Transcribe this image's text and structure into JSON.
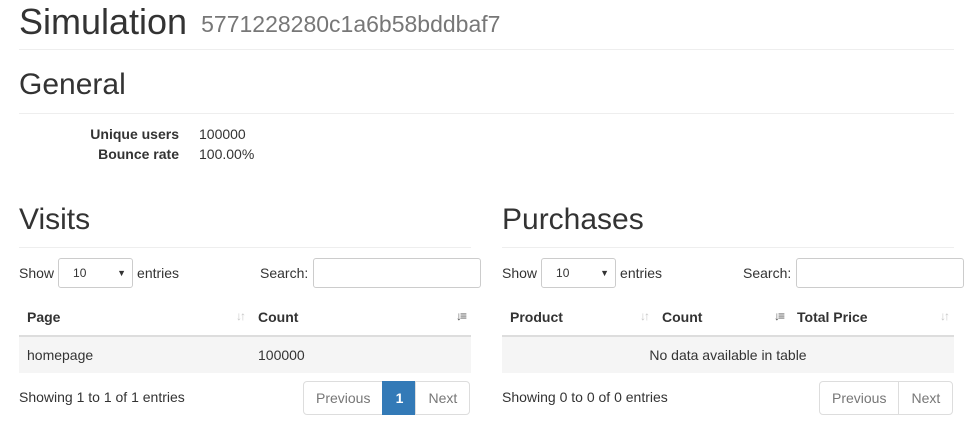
{
  "header": {
    "title": "Simulation",
    "subtitle": "5771228280c1a6b58bddbaf7"
  },
  "general": {
    "title": "General",
    "stats": [
      {
        "label": "Unique users",
        "value": "100000"
      },
      {
        "label": "Bounce rate",
        "value": "100.00%"
      }
    ]
  },
  "visits": {
    "title": "Visits",
    "length": {
      "show_label": "Show",
      "selected": "10",
      "entries_label": "entries"
    },
    "search": {
      "label": "Search:",
      "value": "",
      "placeholder": ""
    },
    "columns": [
      "Page",
      "Count"
    ],
    "rows": [
      [
        "homepage",
        "100000"
      ]
    ],
    "info": "Showing 1 to 1 of 1 entries",
    "pager": {
      "previous": "Previous",
      "current": "1",
      "next": "Next"
    }
  },
  "purchases": {
    "title": "Purchases",
    "length": {
      "show_label": "Show",
      "selected": "10",
      "entries_label": "entries"
    },
    "search": {
      "label": "Search:",
      "value": "",
      "placeholder": ""
    },
    "columns": [
      "Product",
      "Count",
      "Total Price"
    ],
    "empty_message": "No data available in table",
    "info": "Showing 0 to 0 of 0 entries",
    "pager": {
      "previous": "Previous",
      "next": "Next"
    }
  },
  "icons": {
    "sort_both": "sort-both-icon",
    "sort_desc": "sort-desc-icon",
    "select_caret": "caret-down-icon"
  },
  "colors": {
    "accent": "#337ab7",
    "muted_text": "#777777",
    "row_bg": "#f5f5f5"
  }
}
